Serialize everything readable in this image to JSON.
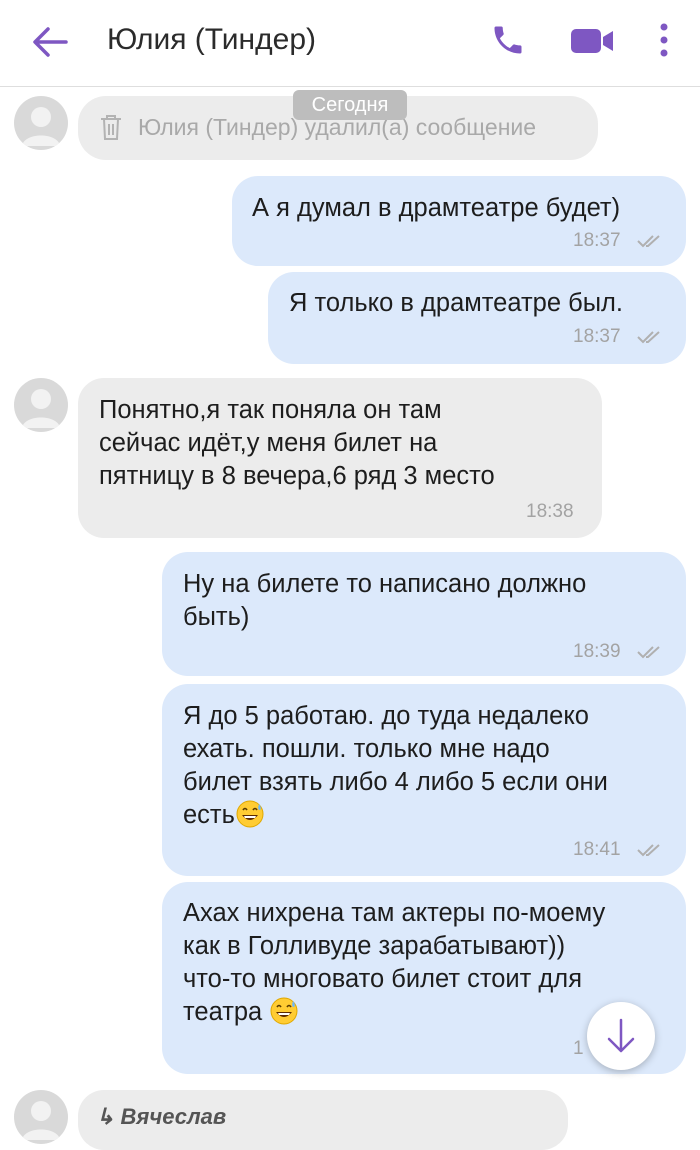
{
  "header": {
    "title": "Юлия (Тиндер)"
  },
  "date_separator": "Сегодня",
  "deleted_notice": "Юлия (Тиндер) удалил(а) сообщение",
  "messages": [
    {
      "direction": "out",
      "lines": [
        "А я думал в драмтеатре будет)"
      ],
      "time": "18:37"
    },
    {
      "direction": "out",
      "lines": [
        "Я только в драмтеатре был."
      ],
      "time": "18:37"
    },
    {
      "direction": "in",
      "lines": [
        "Понятно,я так поняла он там",
        "сейчас идёт,у меня билет на",
        "пятницу в 8 вечера,6 ряд 3 место"
      ],
      "time": "18:38"
    },
    {
      "direction": "out",
      "lines": [
        "Ну на билете то написано должно",
        "быть)"
      ],
      "time": "18:39"
    },
    {
      "direction": "out",
      "lines": [
        "Я до 5 работаю. до туда недалеко",
        "ехать. пошли. только мне надо",
        "билет взять либо 4 либо 5 если они",
        "есть"
      ],
      "time": "18:41"
    },
    {
      "direction": "out",
      "lines": [
        "Ахах нихрена там актеры по-моему",
        "как в Голливуде зарабатывают))",
        "что-то многовато билет стоит для",
        "театра"
      ],
      "time": "1"
    }
  ],
  "reply_preview": "↳ Вячеслав",
  "icons": {
    "back": "back-arrow-icon",
    "call": "phone-icon",
    "video": "video-camera-icon",
    "more": "more-vertical-icon",
    "trash": "trash-icon",
    "read": "double-check-icon",
    "emoji": "grinning-face-with-sweat-emoji",
    "scroll": "arrow-down-icon"
  },
  "colors": {
    "accent": "#7e57c2",
    "outgoing_bubble": "#dce9fb",
    "incoming_bubble": "#ececec"
  }
}
